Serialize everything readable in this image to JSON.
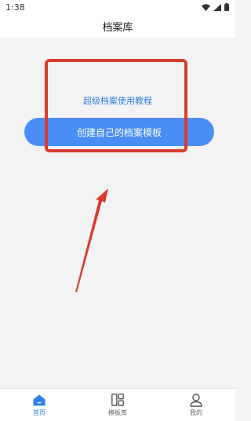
{
  "status_bar": {
    "time": "1:38"
  },
  "header": {
    "title": "档案库"
  },
  "main": {
    "tutorial_link": "超级档案使用教程",
    "create_button": "创建自己的档案模板"
  },
  "bottom_nav": {
    "items": [
      {
        "label": "首页",
        "icon": "home-icon",
        "active": true
      },
      {
        "label": "模板库",
        "icon": "template-library-icon",
        "active": false
      },
      {
        "label": "我的",
        "icon": "profile-icon",
        "active": false
      }
    ]
  },
  "colors": {
    "accent": "#4a8ef5",
    "link": "#2f7fe8",
    "annotation": "#d83a2e"
  }
}
